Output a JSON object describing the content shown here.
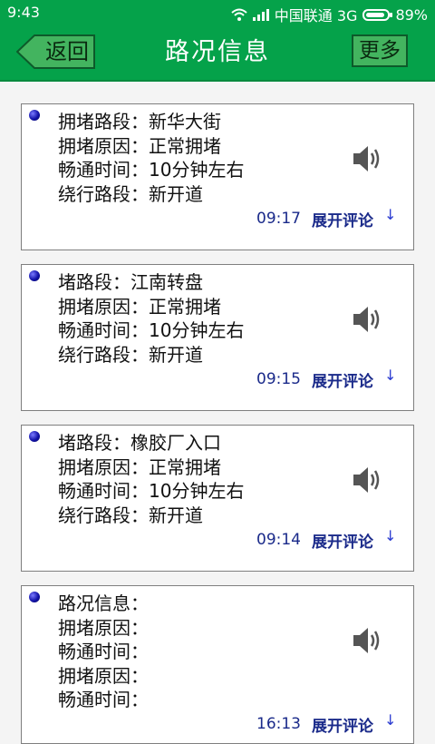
{
  "status_bar": {
    "time": "9:43",
    "carrier": "中国联通 3G",
    "battery": "89%",
    "battery_level": 0.89,
    "icons": [
      "wifi-icon",
      "signal-icon",
      "battery-icon"
    ]
  },
  "header": {
    "back_label": "返回",
    "title": "路况信息",
    "more_label": "更多"
  },
  "colors": {
    "primary_green": "#05a24a",
    "link_blue": "#1a2a8a"
  },
  "cards": [
    {
      "lines": [
        "拥堵路段：新华大街",
        "拥堵原因：正常拥堵",
        "畅通时间：10分钟左右",
        "绕行路段：新开道"
      ],
      "time": "09:17",
      "expand_label": "展开评论",
      "arrow": "↓"
    },
    {
      "lines": [
        "堵路段：江南转盘",
        "拥堵原因：正常拥堵",
        "畅通时间：10分钟左右",
        "绕行路段：新开道"
      ],
      "time": "09:15",
      "expand_label": "展开评论",
      "arrow": "↓"
    },
    {
      "lines": [
        "堵路段：橡胶厂入口",
        "拥堵原因：正常拥堵",
        "畅通时间：10分钟左右",
        "绕行路段：新开道"
      ],
      "time": "09:14",
      "expand_label": "展开评论",
      "arrow": "↓"
    },
    {
      "lines": [
        "路况信息：",
        "拥堵原因：",
        "畅通时间：",
        "拥堵原因：",
        "畅通时间："
      ],
      "time": "16:13",
      "expand_label": "展开评论",
      "arrow": "↓"
    }
  ]
}
